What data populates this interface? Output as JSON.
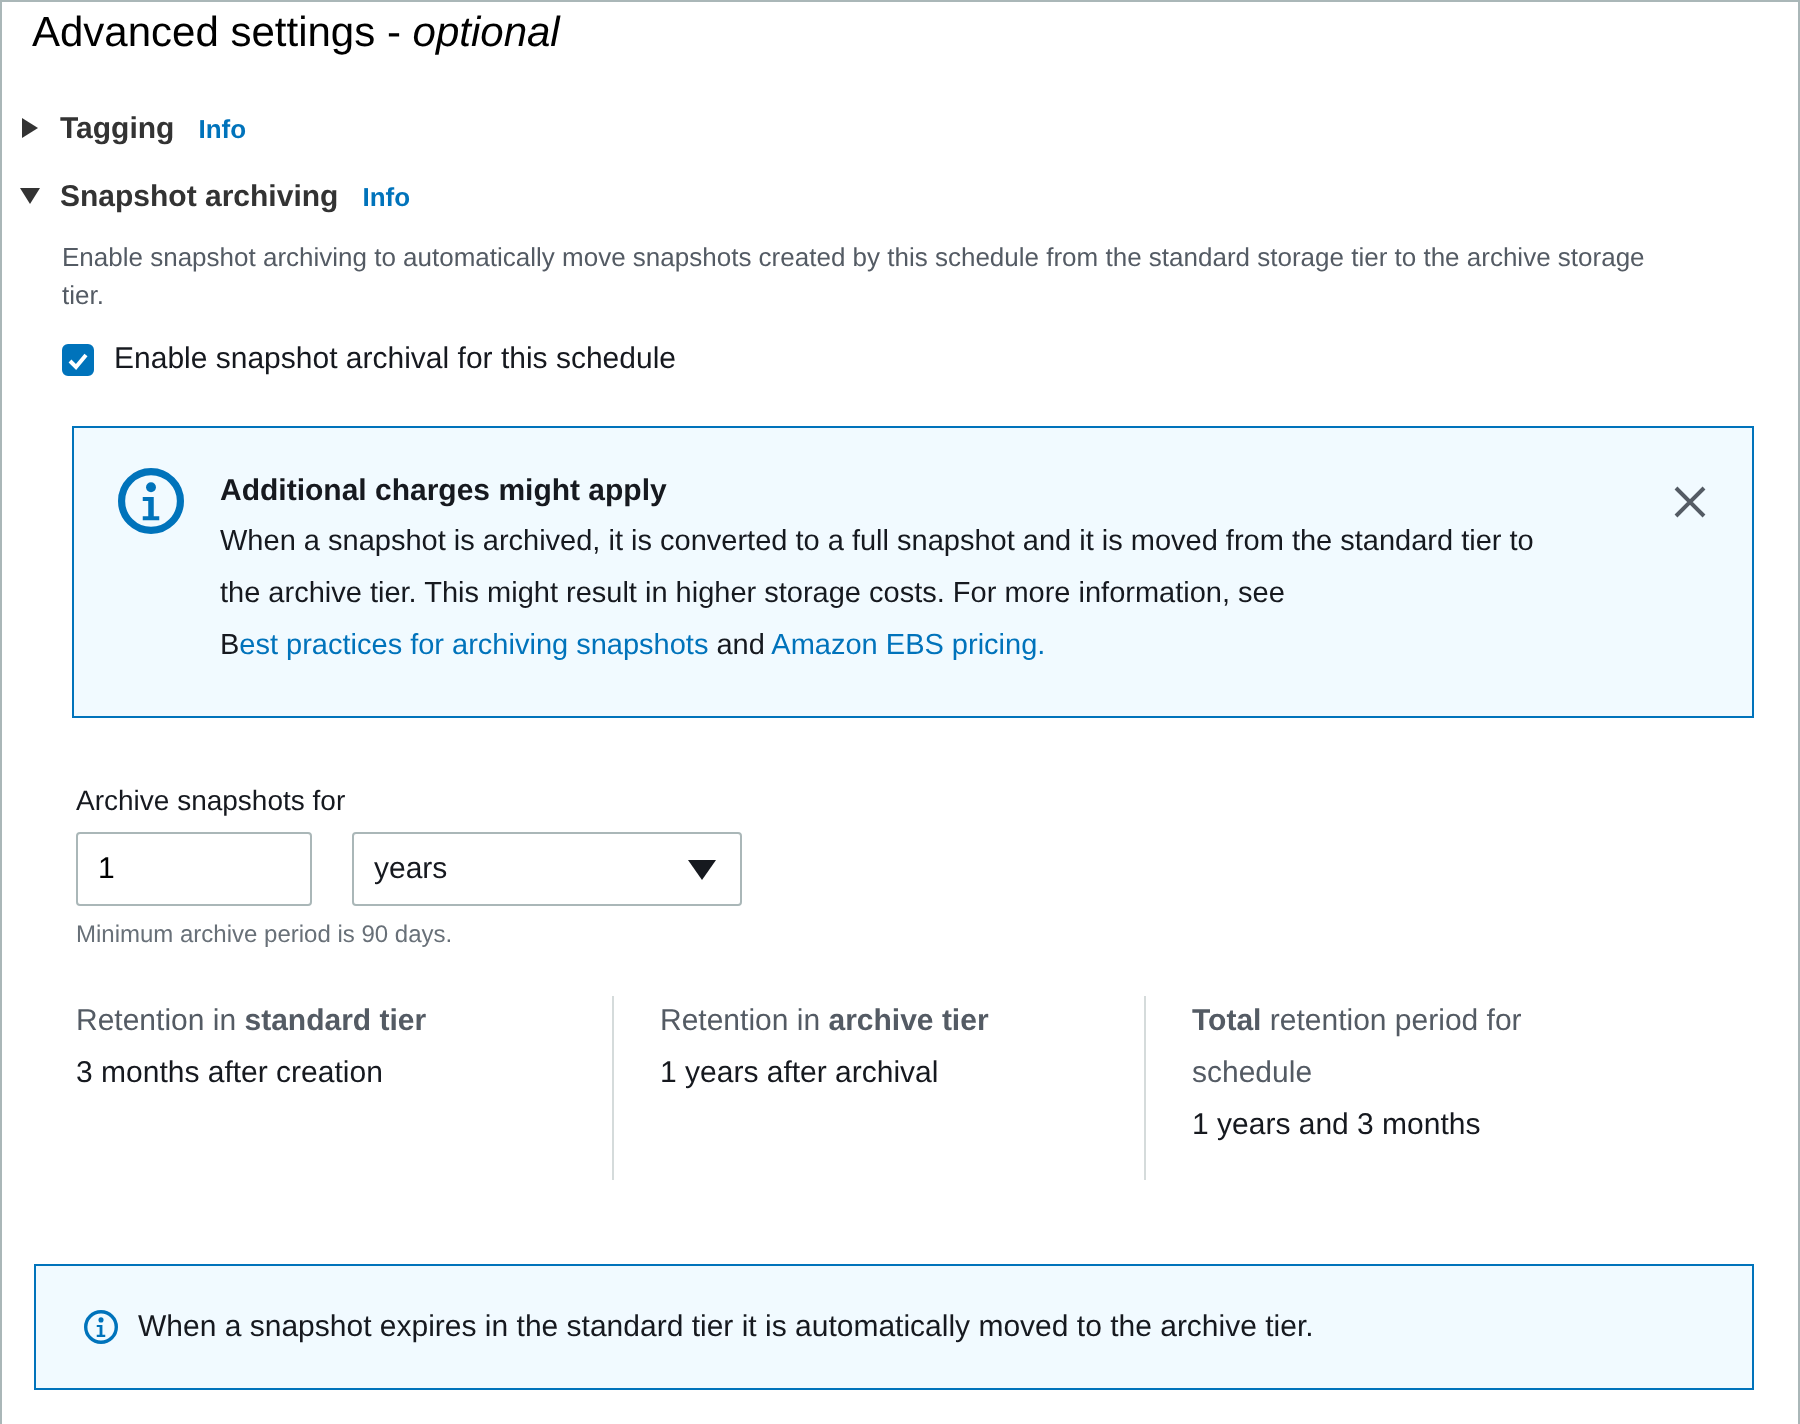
{
  "title": "Advanced settings -",
  "title_suffix": "optional",
  "sections": [
    {
      "label": "Tagging",
      "info": "Info",
      "expanded": false
    },
    {
      "label": "Snapshot archiving",
      "info": "Info",
      "expanded": true
    }
  ],
  "description": "Enable snapshot archiving to automatically move snapshots created by this schedule from the standard storage tier to the archive storage tier.",
  "checkbox": {
    "label": "Enable snapshot archival for this schedule",
    "checked": true
  },
  "alert": {
    "title": "Additional charges might apply",
    "text": "When a snapshot is archived, it is converted to a full snapshot and it is moved from the standard tier to the archive tier. This might result in higher storage costs. For more information, see B",
    "link1": "est practices for archiving snapshots",
    "middle": "and",
    "link2": "Amazon EBS pricing."
  },
  "archive": {
    "label": "Archive snapshots for",
    "value": "1",
    "unit": "years",
    "hint": "Minimum archive period is 90 days."
  },
  "retention": [
    {
      "label": "Retention in **standard tier**",
      "value": "3 months after creation"
    },
    {
      "label": "Retention in **archive tier**",
      "value": "1 years after archival"
    },
    {
      "label": "**Total** retention period for schedule",
      "value": "1 years and 3 months"
    }
  ],
  "note": "When a snapshot expires in the standard tier it is automatically moved to the archive tier."
}
